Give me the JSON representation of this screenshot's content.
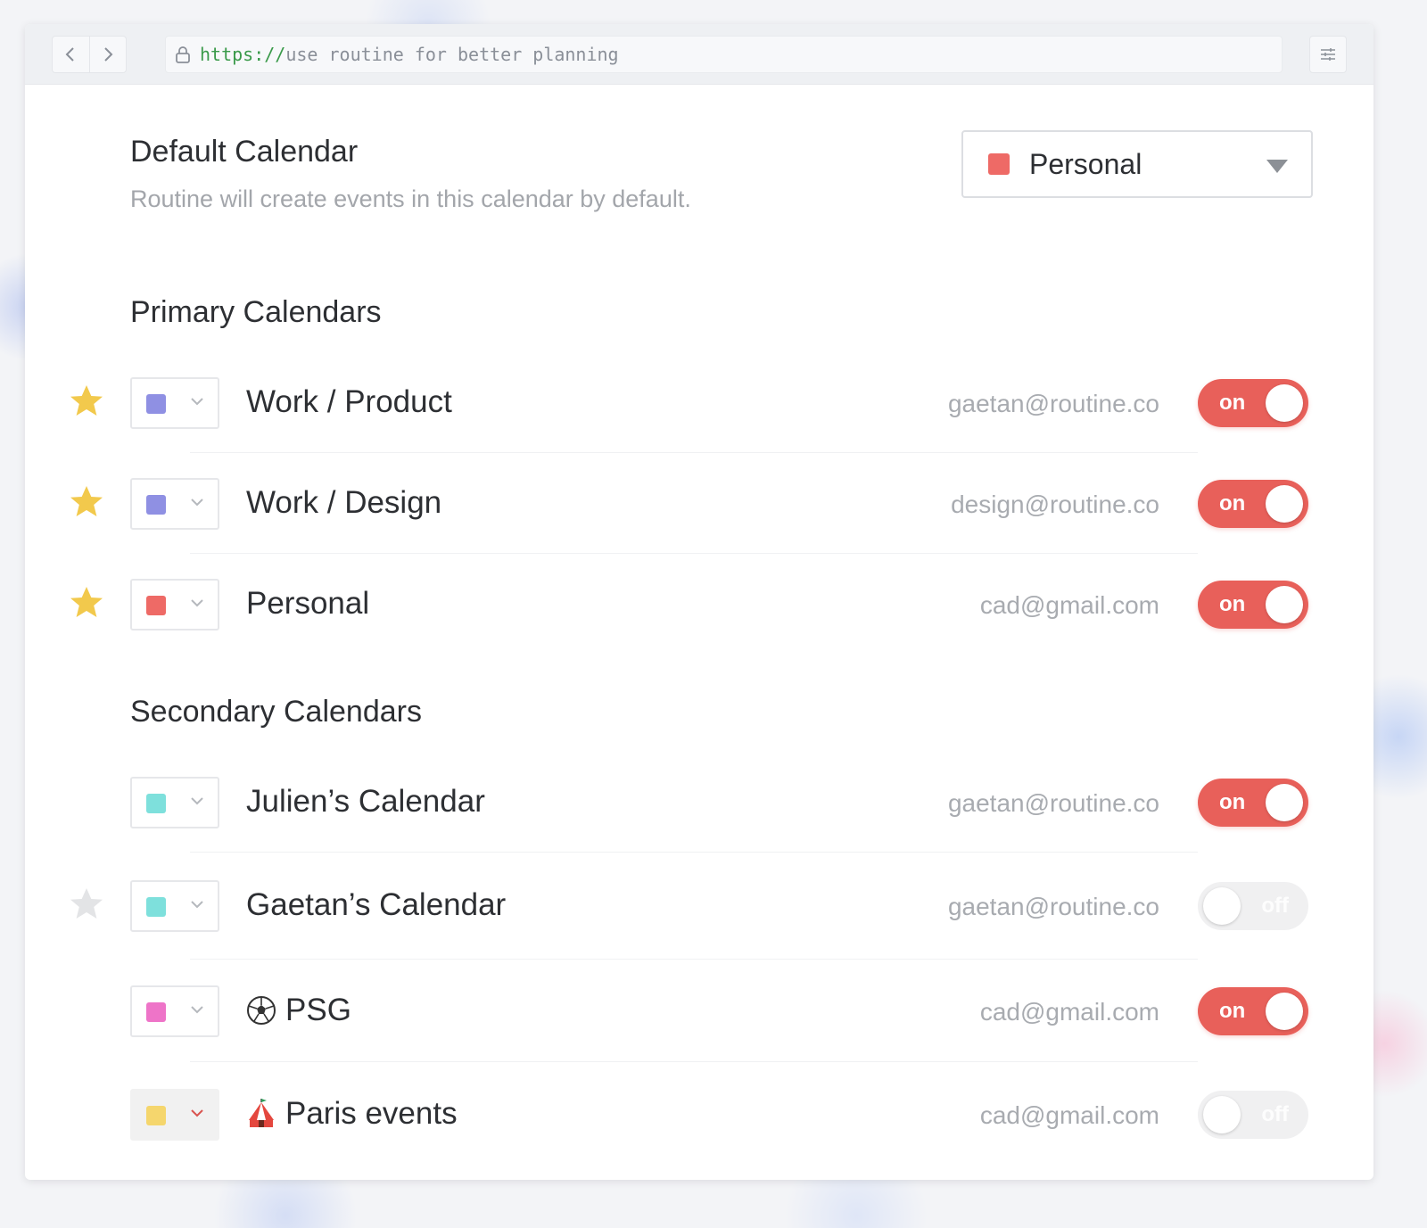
{
  "browser": {
    "url_scheme": "https://",
    "url_rest": "use routine for better planning"
  },
  "default_calendar": {
    "title": "Default Calendar",
    "description": "Routine will create events in this calendar by default.",
    "selected": "Personal",
    "selected_color": "#ee6a66"
  },
  "primary": {
    "title": "Primary Calendars",
    "items": [
      {
        "name": "Work / Product",
        "email": "gaetan@routine.co",
        "color": "#8f90e3",
        "starred": true,
        "toggle": "on",
        "enabled": true
      },
      {
        "name": "Work / Design",
        "email": "design@routine.co",
        "color": "#8f90e3",
        "starred": true,
        "toggle": "on",
        "enabled": true
      },
      {
        "name": "Personal",
        "email": "cad@gmail.com",
        "color": "#ee6a66",
        "starred": true,
        "toggle": "on",
        "enabled": true
      }
    ]
  },
  "secondary": {
    "title": "Secondary Calendars",
    "items": [
      {
        "name": "Julien’s Calendar",
        "email": "gaetan@routine.co",
        "color": "#7ee0dc",
        "starred": false,
        "toggle": "on",
        "enabled": true
      },
      {
        "name": "Gaetan’s Calendar",
        "email": "gaetan@routine.co",
        "color": "#7ee0dc",
        "starred": false,
        "toggle": "off",
        "enabled": false
      },
      {
        "name": "PSG",
        "emoji": "soccer-ball-icon",
        "email": "cad@gmail.com",
        "color": "#ee74c8",
        "starred": false,
        "toggle": "on",
        "enabled": true
      },
      {
        "name": "Paris events",
        "emoji": "circus-tent-icon",
        "email": "cad@gmail.com",
        "color": "#f5d66d",
        "starred": false,
        "toggle": "off",
        "enabled": false
      }
    ]
  },
  "colors": {
    "accent": "#e8605a",
    "star_active": "#f2c94c",
    "star_inactive": "#e3e4e6"
  }
}
